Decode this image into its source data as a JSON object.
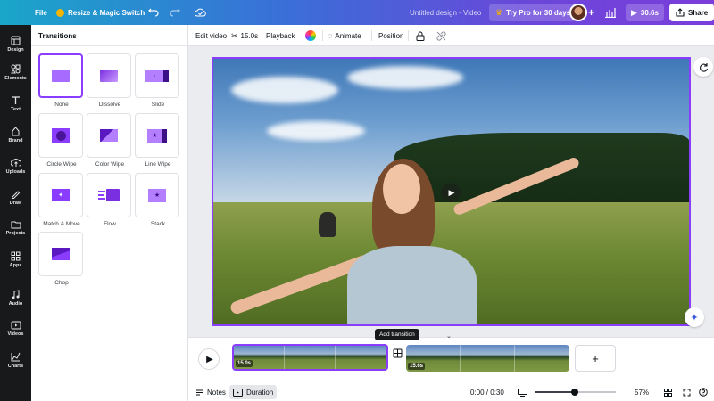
{
  "topbar": {
    "file_label": "File",
    "resize_label": "Resize & Magic Switch",
    "design_title": "Untitled design - Video",
    "pro_label": "Try Pro for 30 days",
    "play_duration": "30.6s",
    "share_label": "Share"
  },
  "rail": {
    "items": [
      {
        "label": "Design"
      },
      {
        "label": "Elements"
      },
      {
        "label": "Text"
      },
      {
        "label": "Brand"
      },
      {
        "label": "Uploads"
      },
      {
        "label": "Draw"
      },
      {
        "label": "Projects"
      },
      {
        "label": "Apps"
      },
      {
        "label": "Audio"
      },
      {
        "label": "Videos"
      },
      {
        "label": "Charts"
      }
    ]
  },
  "panel": {
    "title": "Transitions",
    "transitions": [
      {
        "label": "None",
        "selected": true
      },
      {
        "label": "Dissolve"
      },
      {
        "label": "Slide"
      },
      {
        "label": "Circle Wipe"
      },
      {
        "label": "Color Wipe"
      },
      {
        "label": "Line Wipe"
      },
      {
        "label": "Match & Move"
      },
      {
        "label": "Flow"
      },
      {
        "label": "Stack"
      },
      {
        "label": "Chop"
      }
    ]
  },
  "toolbar": {
    "edit_video": "Edit video",
    "duration": "15.0s",
    "playback": "Playback",
    "animate": "Animate",
    "position": "Position"
  },
  "timeline": {
    "tooltip": "Add transition",
    "clips": [
      {
        "duration": "15.0s",
        "selected": true
      },
      {
        "duration": "15.6s",
        "selected": false
      }
    ],
    "notes_label": "Notes",
    "duration_label": "Duration",
    "time_display": "0:00 / 0:30",
    "zoom": "57%",
    "zoom_fraction": 0.48
  },
  "colors": {
    "accent": "#8b3dff",
    "rail_bg": "#18191b"
  }
}
